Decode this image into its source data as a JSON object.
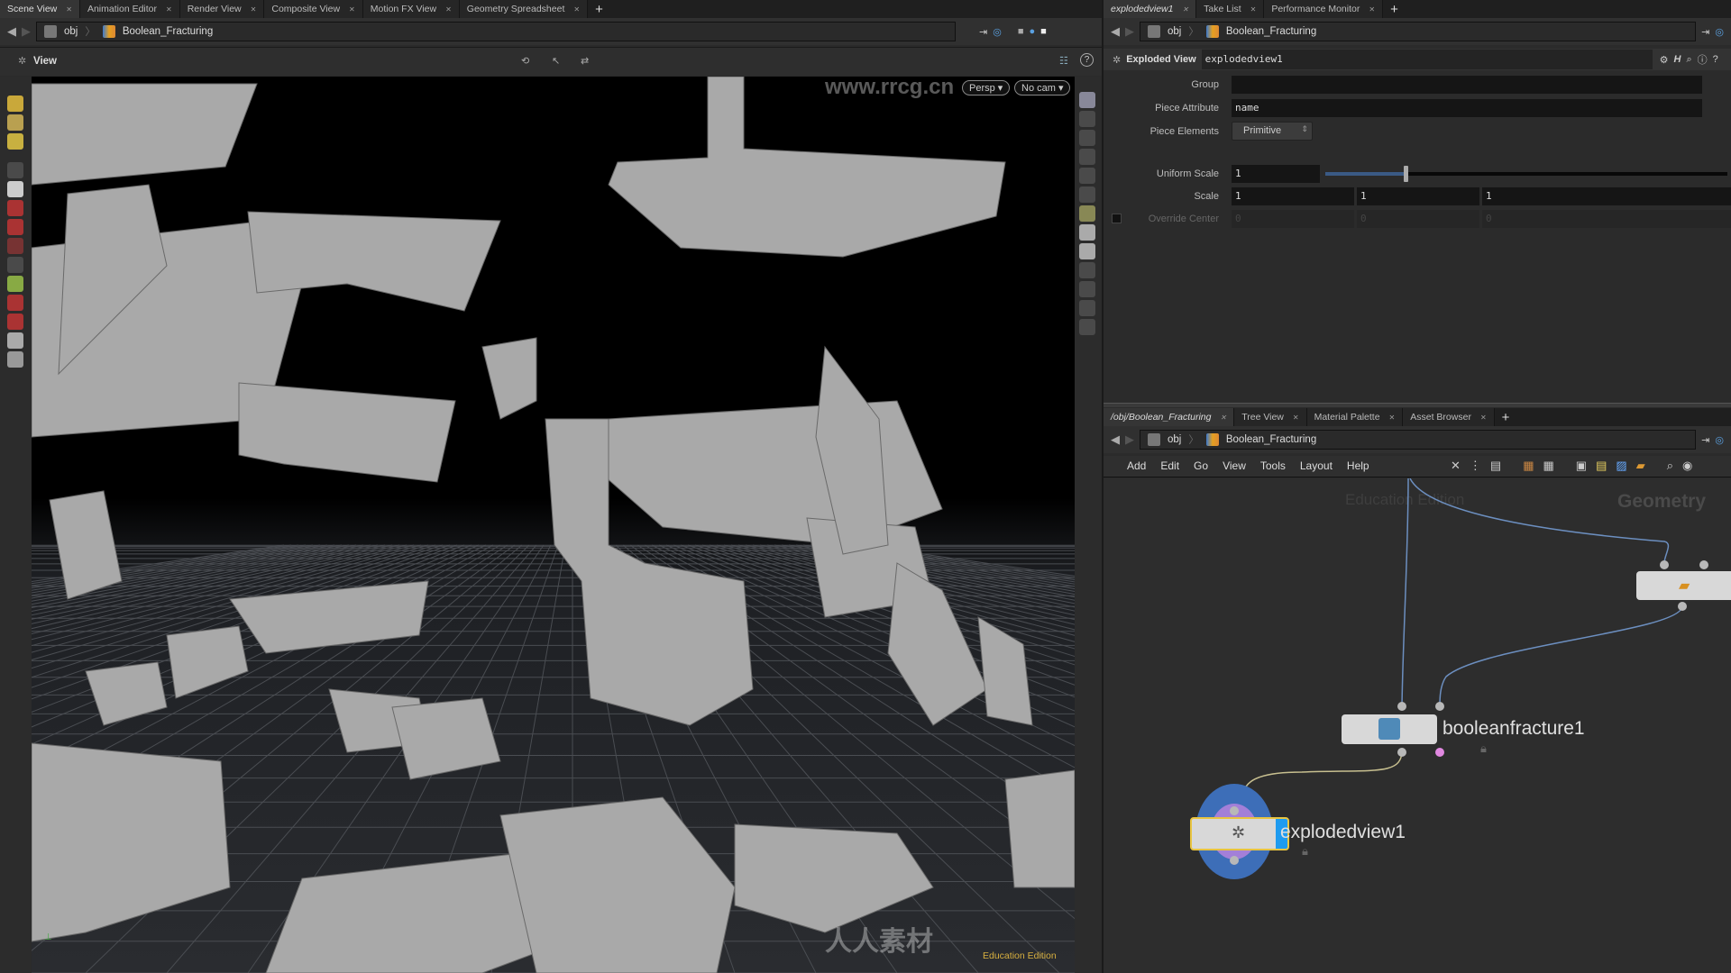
{
  "left_tabs": [
    {
      "label": "Scene View",
      "active": true
    },
    {
      "label": "Animation Editor"
    },
    {
      "label": "Render View"
    },
    {
      "label": "Composite View"
    },
    {
      "label": "Motion FX View"
    },
    {
      "label": "Geometry Spreadsheet"
    }
  ],
  "path": {
    "root": "obj",
    "node": "Boolean_Fracturing"
  },
  "viewport": {
    "title": "View",
    "camera_mode": "Persp",
    "camera": "No cam",
    "edition": "Education Edition"
  },
  "watermarks": {
    "site": "www.rrcg.cn",
    "brand": "RRCG",
    "cn": "人人素材"
  },
  "right_tabs": [
    {
      "label": "explodedview1",
      "active": true
    },
    {
      "label": "Take List"
    },
    {
      "label": "Performance Monitor"
    }
  ],
  "params": {
    "node_type": "Exploded View",
    "node_name": "explodedview1",
    "group_label": "Group",
    "group_value": "",
    "piece_attr_label": "Piece Attribute",
    "piece_attr_value": "name",
    "piece_elements_label": "Piece Elements",
    "piece_elements_value": "Primitive",
    "uniform_scale_label": "Uniform Scale",
    "uniform_scale_value": "1",
    "uniform_scale_slider_fraction": 0.2,
    "scale_label": "Scale",
    "scale": [
      "1",
      "1",
      "1"
    ],
    "override_center_label": "Override Center",
    "override_center": [
      "0",
      "0",
      "0"
    ],
    "override_center_checked": false
  },
  "network_tabs": [
    {
      "label": "/obj/Boolean_Fracturing",
      "active": true
    },
    {
      "label": "Tree View"
    },
    {
      "label": "Material Palette"
    },
    {
      "label": "Asset Browser"
    }
  ],
  "network_menu": [
    "Add",
    "Edit",
    "Go",
    "View",
    "Tools",
    "Layout",
    "Help"
  ],
  "network": {
    "watermark": "Education Edition",
    "context": "Geometry",
    "nodes": [
      {
        "name": "booleanfracture1"
      },
      {
        "name": "explodedview1",
        "selected": true,
        "display": true
      }
    ]
  },
  "colors": {
    "accent": "#1e9bf0",
    "selection": "#e8c440",
    "wire": "#6c8fc0"
  }
}
